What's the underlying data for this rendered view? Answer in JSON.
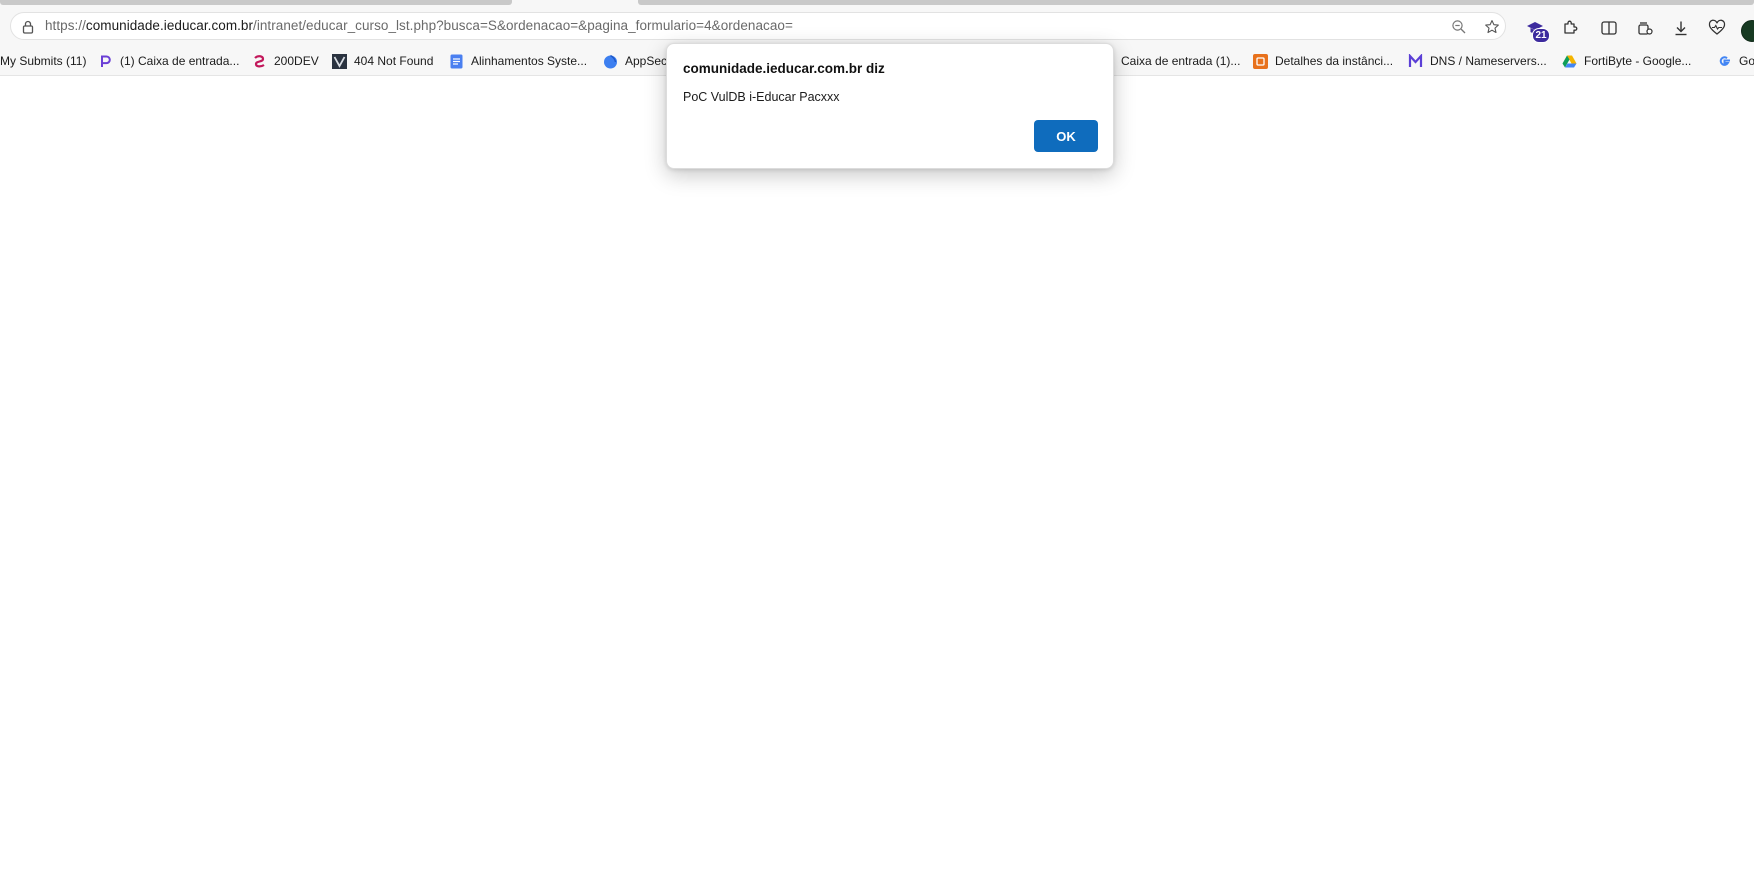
{
  "browser": {
    "url_scheme": "https://",
    "url_host": "comunidade.ieducar.com.br",
    "url_path": "/intranet/educar_curso_lst.php?busca=S&ordenacao=&pagina_formulario=4&ordenacao=",
    "extension_badge": "21"
  },
  "bookmarks": [
    {
      "label": "My Submits (11)",
      "icon": "none"
    },
    {
      "label": "(1) Caixa de entrada...",
      "icon": "p-logo-icon"
    },
    {
      "label": "200DEV",
      "icon": "200dev-logo-icon"
    },
    {
      "label": "404 Not Found",
      "icon": "v-logo-icon"
    },
    {
      "label": "Alinhamentos Syste...",
      "icon": "docs-icon"
    },
    {
      "label": "AppSec",
      "icon": "appsec-drop-icon"
    },
    {
      "label": "Caixa de entrada (1)...",
      "icon": "none"
    },
    {
      "label": "Detalhes da instânci...",
      "icon": "orange-square-icon"
    },
    {
      "label": "DNS / Nameservers...",
      "icon": "dns-logo-icon"
    },
    {
      "label": "FortiByte - Google...",
      "icon": "google-drive-icon"
    },
    {
      "label": "Goo",
      "icon": "google-g-icon"
    }
  ],
  "dialog": {
    "title": "comunidade.ieducar.com.br diz",
    "message": "PoC VulDB i-Educar Pacxxx",
    "ok_label": "OK"
  },
  "colors": {
    "accent": "#0f6cbd",
    "toolbar": "#f7f7f7"
  }
}
